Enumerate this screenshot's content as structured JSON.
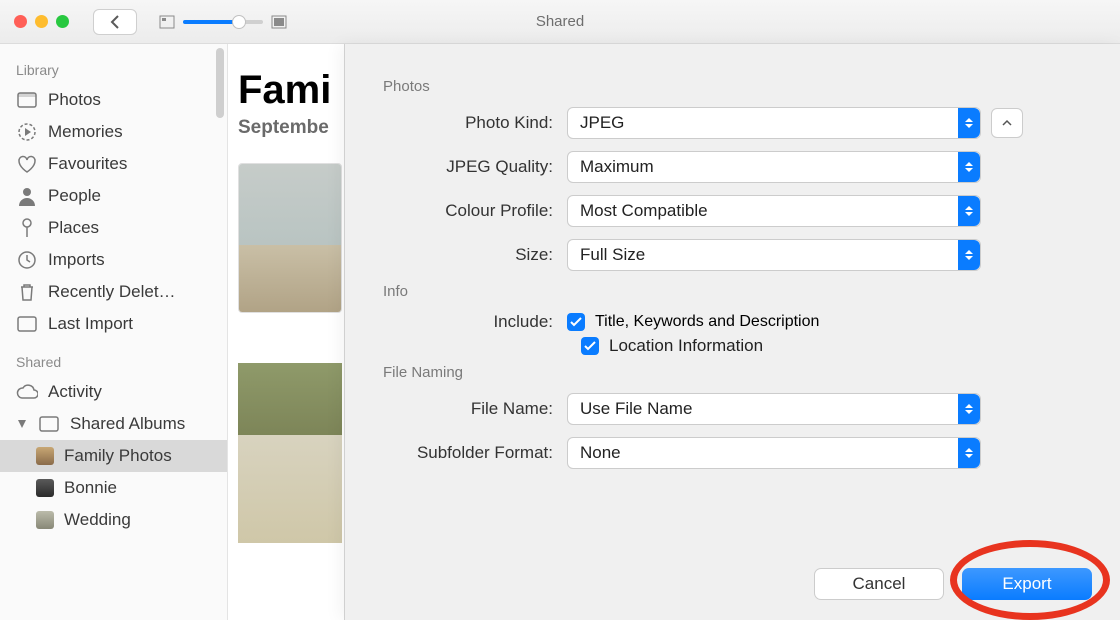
{
  "window_title": "Shared",
  "sidebar": {
    "library_header": "Library",
    "library_items": [
      {
        "label": "Photos",
        "icon": "photos"
      },
      {
        "label": "Memories",
        "icon": "memories"
      },
      {
        "label": "Favourites",
        "icon": "heart"
      },
      {
        "label": "People",
        "icon": "person"
      },
      {
        "label": "Places",
        "icon": "pin"
      },
      {
        "label": "Imports",
        "icon": "clock"
      },
      {
        "label": "Recently Delet…",
        "icon": "trash"
      },
      {
        "label": "Last Import",
        "icon": "lastimport"
      }
    ],
    "shared_header": "Shared",
    "activity_label": "Activity",
    "shared_albums_label": "Shared Albums",
    "shared_children": [
      {
        "label": "Family Photos"
      },
      {
        "label": "Bonnie"
      },
      {
        "label": "Wedding"
      }
    ]
  },
  "main": {
    "title": "Fami",
    "date": "Septembe"
  },
  "sheet": {
    "photos_header": "Photos",
    "info_header": "Info",
    "filenaming_header": "File Naming",
    "photo_kind_label": "Photo Kind:",
    "photo_kind_value": "JPEG",
    "jpeg_quality_label": "JPEG Quality:",
    "jpeg_quality_value": "Maximum",
    "colour_profile_label": "Colour Profile:",
    "colour_profile_value": "Most Compatible",
    "size_label": "Size:",
    "size_value": "Full Size",
    "include_label": "Include:",
    "chk_title_label": "Title, Keywords and Description",
    "chk_location_label": "Location Information",
    "file_name_label": "File Name:",
    "file_name_value": "Use File Name",
    "subfolder_label": "Subfolder Format:",
    "subfolder_value": "None",
    "cancel_label": "Cancel",
    "export_label": "Export"
  }
}
